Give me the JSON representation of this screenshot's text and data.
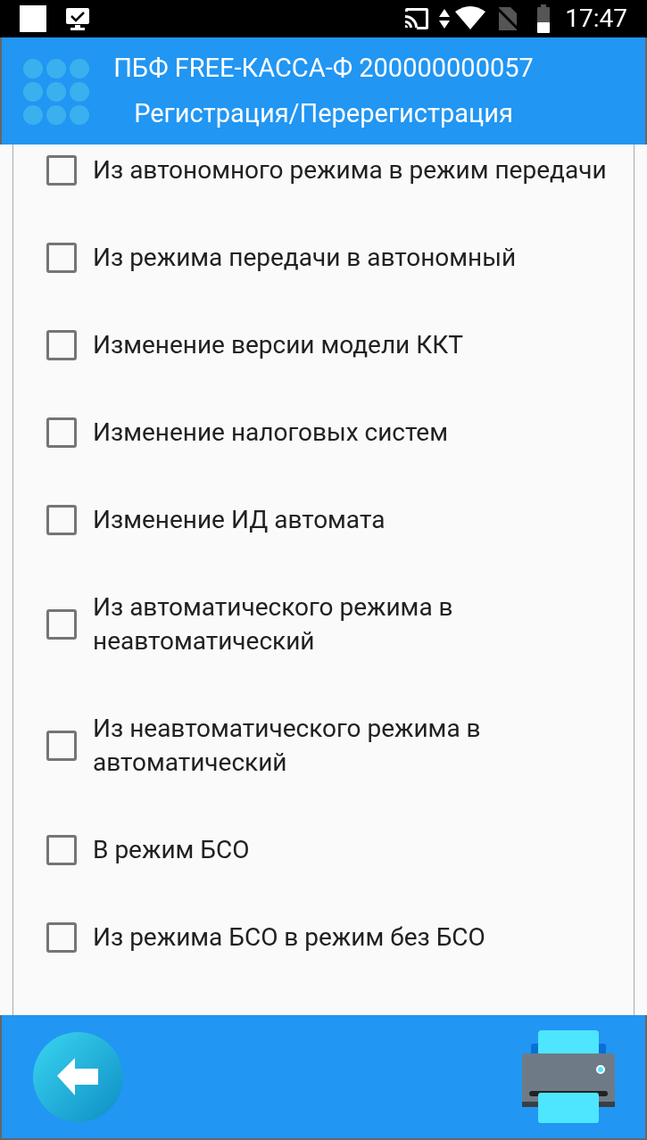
{
  "status_bar": {
    "time": "17:47"
  },
  "header": {
    "title": "ПБФ FREE-КАССА-Ф 200000000057",
    "subtitle": "Регистрация/Перерегистрация"
  },
  "options": [
    {
      "label": "Из автономного режима в режим передачи",
      "checked": false
    },
    {
      "label": "Из режима передачи в автономный",
      "checked": false
    },
    {
      "label": "Изменение версии модели ККТ",
      "checked": false
    },
    {
      "label": "Изменение налоговых систем",
      "checked": false
    },
    {
      "label": "Изменение ИД автомата",
      "checked": false
    },
    {
      "label": "Из автоматического режима в неавтоматический",
      "checked": false
    },
    {
      "label": "Из неавтоматического режима в автоматический",
      "checked": false
    },
    {
      "label": "В режим БСО",
      "checked": false
    },
    {
      "label": "Из режима БСО в режим без БСО",
      "checked": false
    }
  ]
}
